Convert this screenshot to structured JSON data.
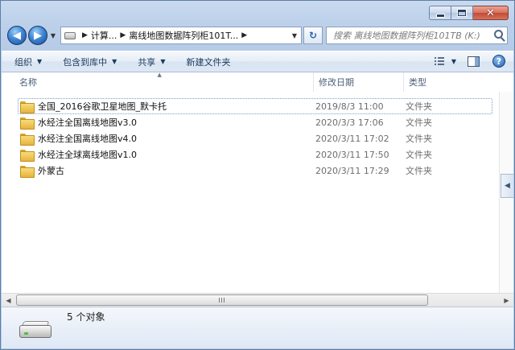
{
  "window": {
    "caption": {
      "minimize_icon": "minimize-icon",
      "maximize_icon": "maximize-icon",
      "close_icon": "close-icon",
      "close_glyph": "✕"
    }
  },
  "nav": {
    "back_glyph": "◀",
    "forward_glyph": "▶",
    "breadcrumbs": [
      "计算...",
      "离线地图数据阵列柜101T..."
    ],
    "refresh_glyph": "↻",
    "search_placeholder": "搜索 离线地图数据阵列柜101TB (K:)"
  },
  "toolbar": {
    "organize": "组织",
    "include_in_library": "包含到库中",
    "share": "共享",
    "new_folder": "新建文件夹",
    "help_glyph": "?"
  },
  "columns": {
    "name": "名称",
    "date": "修改日期",
    "type": "类型"
  },
  "files": [
    {
      "name": "全国_2016谷歌卫星地图_默卡托",
      "date": "2019/8/3 11:00",
      "type": "文件夹"
    },
    {
      "name": "水经注全国离线地图v3.0",
      "date": "2020/3/3 17:06",
      "type": "文件夹"
    },
    {
      "name": "水经注全国离线地图v4.0",
      "date": "2020/3/11 17:02",
      "type": "文件夹"
    },
    {
      "name": "水经注全球离线地图v1.0",
      "date": "2020/3/11 17:50",
      "type": "文件夹"
    },
    {
      "name": "外蒙古",
      "date": "2020/3/11 17:29",
      "type": "文件夹"
    }
  ],
  "status": {
    "count": "5 个对象"
  },
  "colors": {
    "chrome": "#bcd0ea",
    "toolbar_text": "#1e395b",
    "folder": "#e7b43a",
    "close": "#c24a34"
  }
}
